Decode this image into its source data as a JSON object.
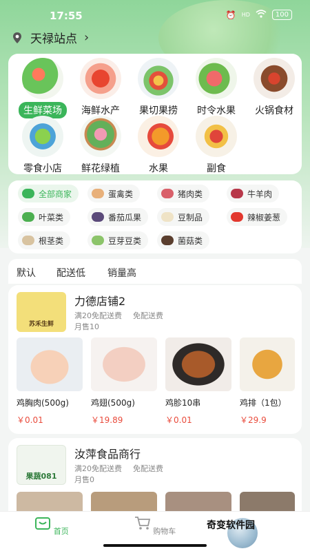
{
  "status": {
    "time": "17:55",
    "battery": "100",
    "signal": "HD"
  },
  "location": {
    "name": "天禄站点",
    "chevron": "›"
  },
  "categories": [
    {
      "label": "生鲜菜场",
      "active": true
    },
    {
      "label": "海鲜水产"
    },
    {
      "label": "果切果捞"
    },
    {
      "label": "时令水果"
    },
    {
      "label": "火锅食材"
    },
    {
      "label": "零食小店"
    },
    {
      "label": "鲜花绿植"
    },
    {
      "label": "水果"
    },
    {
      "label": "副食"
    }
  ],
  "tags": [
    {
      "label": "全部商家",
      "active": true
    },
    {
      "label": "蛋禽类"
    },
    {
      "label": "猪肉类"
    },
    {
      "label": "牛羊肉"
    },
    {
      "label": "叶菜类"
    },
    {
      "label": "番茄瓜果"
    },
    {
      "label": "豆制品"
    },
    {
      "label": "辣椒姜葱"
    },
    {
      "label": "根茎类"
    },
    {
      "label": "豆芽豆类"
    },
    {
      "label": "菌菇类"
    }
  ],
  "sort": {
    "default": "默认",
    "delivery_low": "配送低",
    "sales_high": "销量高"
  },
  "shops": [
    {
      "name": "力德店铺2",
      "logo_text": "苏禾生鲜",
      "min_order": "满20免配送费",
      "delivery": "免配送费",
      "sales": "月售10",
      "products": [
        {
          "name": "鸡胸肉(500g)",
          "price": "￥0.01"
        },
        {
          "name": "鸡翅(500g)",
          "price": "￥19.89"
        },
        {
          "name": "鸡胗10串",
          "price": "￥0.01"
        },
        {
          "name": "鸡排（1包）",
          "price": "￥29.9"
        }
      ]
    },
    {
      "name": "汝萍食品商行",
      "logo_text": "果蔬081",
      "min_order": "满20免配送费",
      "delivery": "免配送费",
      "sales": "月售0"
    }
  ],
  "tabbar": {
    "home": "首页",
    "cart": "购物车"
  },
  "watermark": "奇变软件园",
  "colors": {
    "accent": "#3bb55a",
    "price": "#e94b3c"
  }
}
